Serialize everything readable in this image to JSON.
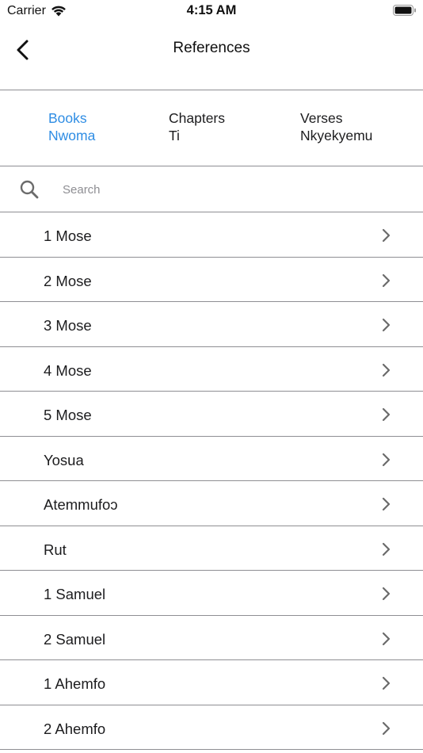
{
  "status_bar": {
    "carrier": "Carrier",
    "time": "4:15 AM"
  },
  "nav": {
    "title": "References",
    "back_icon": "chevron-left-icon"
  },
  "tabs": [
    {
      "line1": "Books",
      "line2": "Nwoma",
      "active": true
    },
    {
      "line1": "Chapters",
      "line2": "Ti",
      "active": false
    },
    {
      "line1": "Verses",
      "line2": "Nkyekyemu",
      "active": false
    }
  ],
  "search": {
    "placeholder": "Search",
    "value": ""
  },
  "books": [
    "1 Mose",
    "2 Mose",
    "3 Mose",
    "4 Mose",
    "5 Mose",
    "Yosua",
    "Atemmufoɔ",
    "Rut",
    "1 Samuel",
    "2 Samuel",
    "1 Ahemfo",
    "2 Ahemfo"
  ],
  "colors": {
    "accent": "#2f8de4",
    "divider": "#8e8e93",
    "text": "#1c1c1e",
    "chevron": "#6b6b6b"
  }
}
